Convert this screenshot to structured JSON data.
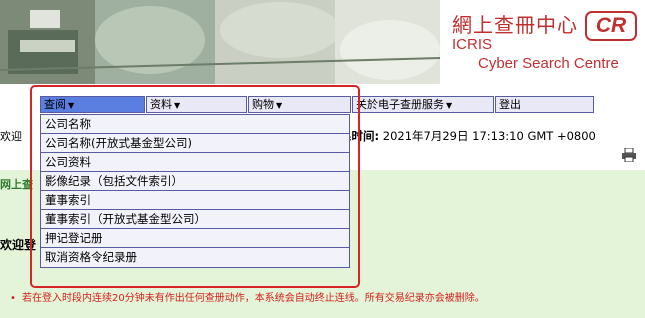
{
  "header": {
    "brand_cn": "網上查冊中心",
    "brand_logo": "CR",
    "brand_icris": "ICRIS",
    "brand_subtitle": "Cyber Search Centre"
  },
  "nav": {
    "tabs": [
      {
        "label": "查阅",
        "arrow": "▼",
        "active": true
      },
      {
        "label": "资料",
        "arrow": "▼",
        "active": false
      },
      {
        "label": "购物",
        "arrow": "▼",
        "active": false
      },
      {
        "label": "关於电子查册服务",
        "arrow": "▼",
        "active": false
      },
      {
        "label": "登出",
        "arrow": "",
        "active": false
      }
    ]
  },
  "dropdown": {
    "items": [
      "公司名称",
      "公司名称(开放式基金型公司)",
      "公司资料",
      "影像纪录（包括文件索引）",
      "董事索引",
      "董事索引（开放式基金型公司）",
      "押记登记册",
      "取消资格令纪录册"
    ]
  },
  "page": {
    "welcome_prefix": "欢迎",
    "time_label": "系时间:",
    "time_value": "2021年7月29日 17:13:10 GMT +0800",
    "green_title": "网上查",
    "welcome_login": "欢迎登",
    "notice": "若在登入时段内连续20分钟未有作出任何查册动作，本系统会自动终止连线。所有交易纪录亦会被删除。",
    "notice_dot": "•"
  },
  "colors": {
    "brand": "#c03030",
    "nav_active": "#5b7fe0",
    "highlight": "#d42424",
    "panel": "#e3f4d8"
  }
}
